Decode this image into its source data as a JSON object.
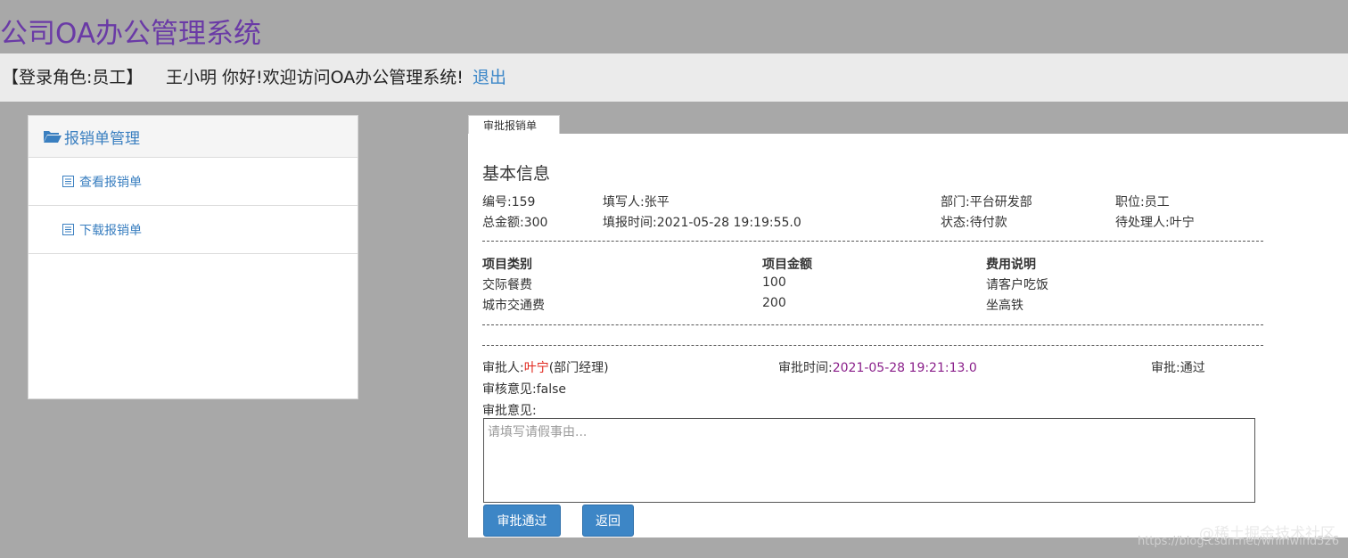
{
  "app": {
    "title": "公司OA办公管理系统"
  },
  "user_bar": {
    "role": "【登录角色:员工】",
    "welcome": "王小明 你好!欢迎访问OA办公管理系统!",
    "logout": "退出"
  },
  "sidebar": {
    "header": "报销单管理",
    "items": [
      {
        "label": "查看报销单"
      },
      {
        "label": "下载报销单"
      }
    ]
  },
  "tab": {
    "label": "审批报销单"
  },
  "basic": {
    "title": "基本信息",
    "number": "编号:159",
    "filler": "填写人:张平",
    "department": "部门:平台研发部",
    "position": "职位:员工",
    "total": "总金额:300",
    "fill_time": "填报时间:2021-05-28 19:19:55.0",
    "status": "状态:待付款",
    "handler": "待处理人:叶宁"
  },
  "items_table": {
    "headers": [
      "项目类别",
      "项目金额",
      "费用说明"
    ],
    "rows": [
      [
        "交际餐费",
        "100",
        "请客户吃饭"
      ],
      [
        "城市交通费",
        "200",
        "坐高铁"
      ]
    ]
  },
  "approval": {
    "approver_label": "审批人:",
    "approver_name": "叶宁",
    "approver_role": "(部门经理)",
    "time_label": "审批时间:",
    "time_value": "2021-05-28 19:21:13.0",
    "result": "审批:通过",
    "review_opinion": "审核意见:false",
    "opinion_label": "审批意见:",
    "opinion_placeholder": "请填写请假事由..."
  },
  "buttons": {
    "approve": "审批通过",
    "back": "返回"
  },
  "watermark": {
    "text": "@稀土掘金技术社区",
    "url": "https://blog.csdn.net/whirlwind526"
  },
  "colors": {
    "title_purple": "#6a3aa6",
    "link_blue": "#3a86c8",
    "button_blue": "#3d86c6",
    "approver_red": "#e0251b",
    "time_purple": "#8a1f8a",
    "page_bg": "#a8a8a8"
  },
  "icons": {
    "sidebar_header": "folder-open-icon",
    "sidebar_item": "list-document-icon"
  }
}
